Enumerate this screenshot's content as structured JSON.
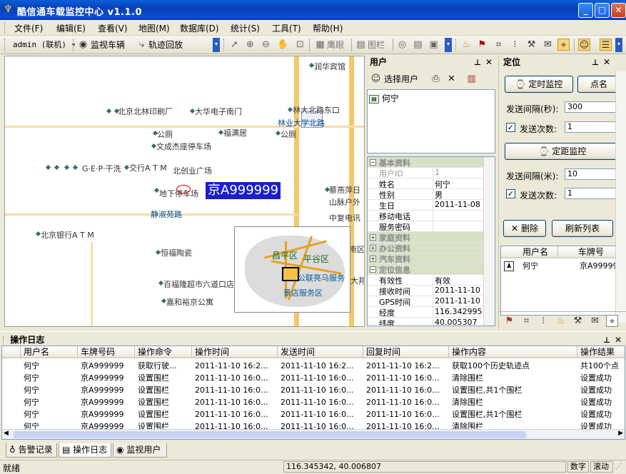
{
  "app": {
    "title": "酷信通车载监控中心 v1.1.0"
  },
  "menu": [
    "文件(F)",
    "编辑(E)",
    "查看(V)",
    "地图(M)",
    "数据库(D)",
    "统计(S)",
    "工具(T)",
    "帮助(H)"
  ],
  "toolbar": {
    "account": "admin (联机)",
    "monitor": "监视车辆",
    "playback": "轨迹回放",
    "eagle_eye": "鹰眼",
    "layers": "图栏"
  },
  "map": {
    "plate_label": "京A999999",
    "labels": [
      "北京北林印刷厂",
      "大华电子南门",
      "林大北路东口",
      "林业大学北路",
      "公厕",
      "福满居",
      "公厕",
      "文成杰座停车场",
      "G·E·P·干洗",
      "交行A T M",
      "北创业广场",
      "地下停车场",
      "静淑苑路",
      "北京银行A T M",
      "恒福陶瓷",
      "百福隆超市六道口店",
      "嘉和裕京公寓",
      "润华宾馆",
      "蔡燕萍日",
      "山脉户外",
      "中复电讯",
      "南区",
      "大邦"
    ],
    "inset_labels": [
      "昌平区",
      "平谷区",
      "公联亮马服务",
      "景店服务区"
    ]
  },
  "user_panel": {
    "title": "用户",
    "select_label": "选择用户",
    "users": [
      "何宁"
    ],
    "sections": {
      "basic": "基本资料",
      "family": "家庭资料",
      "office": "办公资料",
      "car": "汽车资料",
      "location": "定位信息"
    },
    "basic": [
      {
        "k": "用户ID",
        "v": "1"
      },
      {
        "k": "姓名",
        "v": "何宁"
      },
      {
        "k": "性别",
        "v": "男"
      },
      {
        "k": "生日",
        "v": "2011-11-08"
      },
      {
        "k": "移动电话",
        "v": ""
      },
      {
        "k": "服务密码",
        "v": ""
      }
    ],
    "location": [
      {
        "k": "有效性",
        "v": "有效"
      },
      {
        "k": "接收时间",
        "v": "2011-11-10"
      },
      {
        "k": "GPS时间",
        "v": "2011-11-10"
      },
      {
        "k": "经度",
        "v": "116.342995"
      },
      {
        "k": "纬度",
        "v": "40.005307"
      }
    ]
  },
  "locate_panel": {
    "title": "定位",
    "timed_btn": "定时监控",
    "point_btn": "点名",
    "interval_label": "发送间隔(秒):",
    "interval_value": "300",
    "count_label": "发送次数:",
    "count_value": "1",
    "dist_btn": "定距监控",
    "dist_label": "发送间隔(米):",
    "dist_value": "10",
    "count2_label": "发送次数:",
    "count2_value": "1",
    "delete_btn": "删除",
    "refresh_btn": "刷新列表",
    "cols": [
      "用户名",
      "车牌号"
    ],
    "rows": [
      {
        "user": "何宁",
        "plate": "京A99999"
      }
    ]
  },
  "log": {
    "title": "操作日志",
    "cols": [
      "用户名",
      "车牌号码",
      "操作命令",
      "操作时间",
      "发送时间",
      "回复时间",
      "操作内容",
      "操作结果"
    ],
    "rows": [
      [
        "何宁",
        "京A999999",
        "获取行驶...",
        "2011-11-10 16:2...",
        "2011-11-10 16:2...",
        "2011-11-10 16:2...",
        "获取100个历史轨迹点",
        "共100个点"
      ],
      [
        "何宁",
        "京A999999",
        "设置围栏",
        "2011-11-10 16:0...",
        "2011-11-10 16:0...",
        "2011-11-10 16:0...",
        "清除围栏",
        "设置成功"
      ],
      [
        "何宁",
        "京A999999",
        "设置围栏",
        "2011-11-10 16:0...",
        "2011-11-10 16:0...",
        "2011-11-10 16:0...",
        "设置围栏,共1个围栏",
        "设置成功"
      ],
      [
        "何宁",
        "京A999999",
        "设置围栏",
        "2011-11-10 16:0...",
        "2011-11-10 16:0...",
        "2011-11-10 16:0...",
        "清除围栏",
        "设置成功"
      ],
      [
        "何宁",
        "京A999999",
        "设置围栏",
        "2011-11-10 16:0...",
        "2011-11-10 16:0...",
        "2011-11-10 16:0...",
        "设置围栏,共1个围栏",
        "设置成功"
      ],
      [
        "何宁",
        "京A999999",
        "设置围栏",
        "2011-11-10 16:0...",
        "2011-11-10 16:0...",
        "2011-11-10 16:0...",
        "清除围栏",
        "设置成功"
      ]
    ]
  },
  "tabs": [
    "告警记录",
    "操作日志",
    "监视用户"
  ],
  "status": {
    "text": "就绪",
    "coords": "116.345342, 40.006807",
    "num": "数字",
    "scroll": "滚动"
  }
}
